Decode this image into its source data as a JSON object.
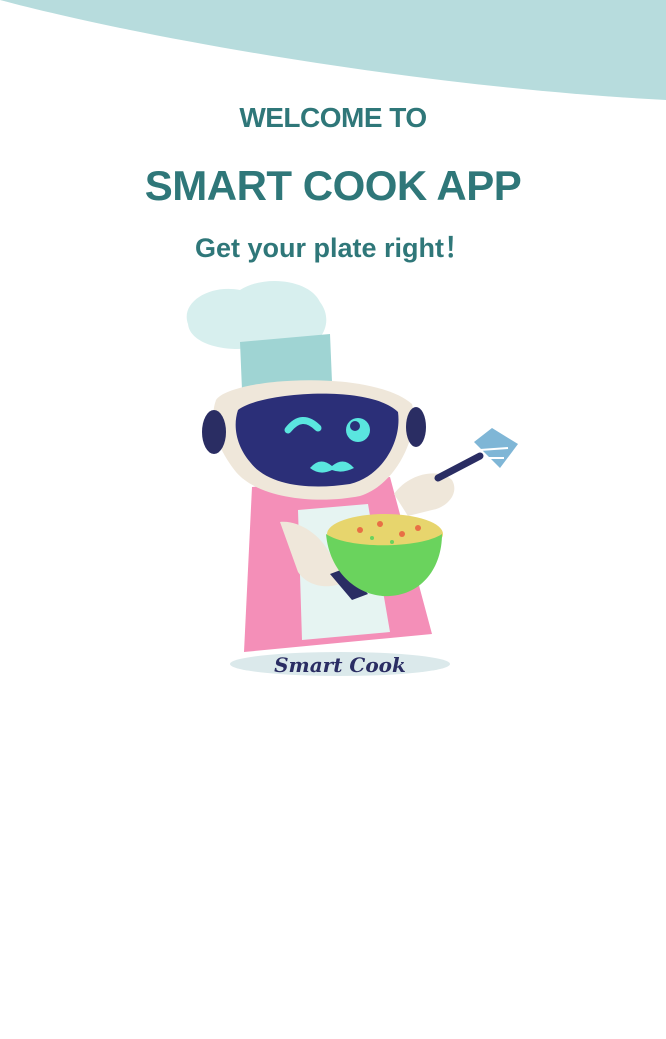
{
  "welcome_text": "WELCOME TO",
  "app_title": "SMART COOK APP",
  "tagline": "Get your plate right！",
  "logo": {
    "caption": "Smart Cook",
    "icon": "chef-robot-mascot"
  },
  "colors": {
    "primary_text": "#2f7779",
    "header_wave": "#b7dcdd",
    "background": "#ffffff"
  }
}
